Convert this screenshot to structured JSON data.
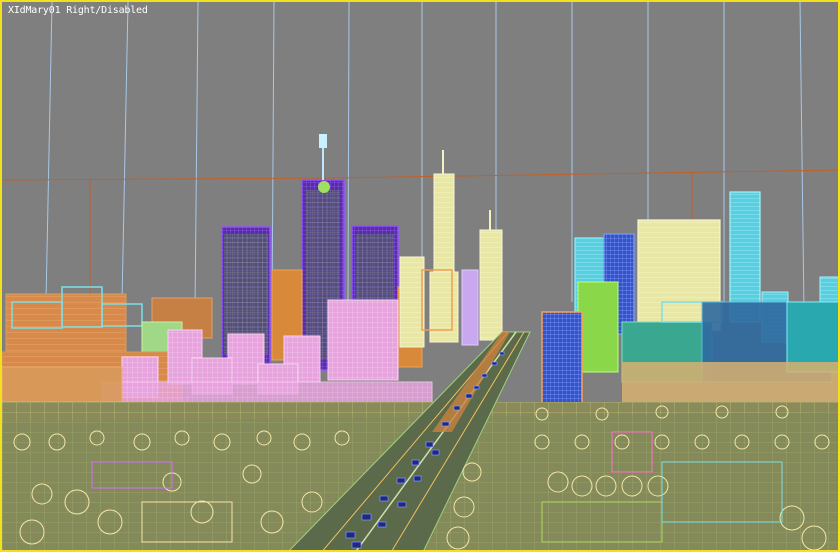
{
  "viewport": {
    "label": "XIdMary01 Right/Disabled",
    "border_color": "#f2e11a",
    "background": "#7f7f7f"
  }
}
